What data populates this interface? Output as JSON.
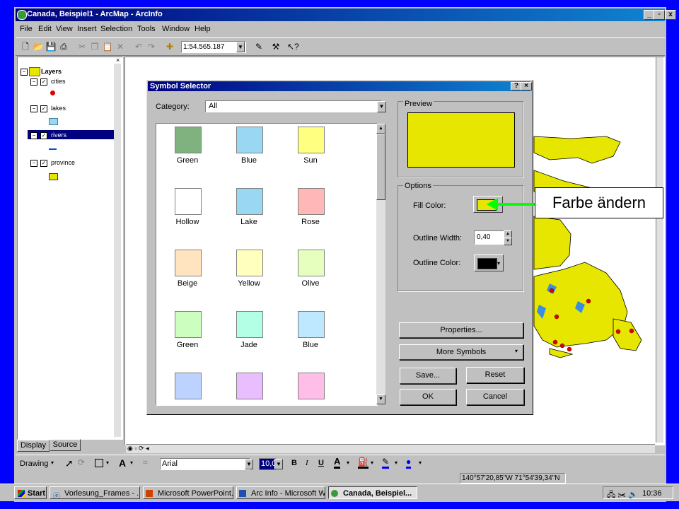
{
  "window": {
    "title": "Canada, Beispiel1 - ArcMap - ArcInfo",
    "controls": [
      "_",
      "▫",
      "x"
    ]
  },
  "menu": [
    "File",
    "Edit",
    "View",
    "Insert",
    "Selection",
    "Tools",
    "Window",
    "Help"
  ],
  "toolbar": {
    "scale": "1:54.565.187"
  },
  "toc": {
    "root": "Layers",
    "layers": [
      {
        "name": "cities",
        "symbol": "red-dot"
      },
      {
        "name": "lakes",
        "symbol": "light-blue-rect"
      },
      {
        "name": "rivers",
        "symbol": "blue-line",
        "selected": true
      },
      {
        "name": "province",
        "symbol": "yellow-rect"
      }
    ],
    "tabs": [
      "Display",
      "Source"
    ]
  },
  "dialog": {
    "title": "Symbol Selector",
    "category_label": "Category:",
    "category_value": "All",
    "symbols": [
      {
        "label": "Green",
        "color": "#7fb27f"
      },
      {
        "label": "Blue",
        "color": "#9ad7f3"
      },
      {
        "label": "Sun",
        "color": "#ffff80"
      },
      {
        "label": "Hollow",
        "color": "#ffffff"
      },
      {
        "label": "Lake",
        "color": "#9ad7f3"
      },
      {
        "label": "Rose",
        "color": "#ffb7b7"
      },
      {
        "label": "Beige",
        "color": "#ffe4bf"
      },
      {
        "label": "Yellow",
        "color": "#ffffbe"
      },
      {
        "label": "Olive",
        "color": "#e6ffbf"
      },
      {
        "label": "Green",
        "color": "#ccffbf"
      },
      {
        "label": "Jade",
        "color": "#b3ffe6"
      },
      {
        "label": "Blue",
        "color": "#bee8ff"
      },
      {
        "label": "",
        "color": "#bed2ff"
      },
      {
        "label": "",
        "color": "#e8beff"
      },
      {
        "label": "",
        "color": "#ffbee8"
      }
    ],
    "preview_label": "Preview",
    "preview_color": "#e6e600",
    "options_label": "Options",
    "fill_color_label": "Fill Color:",
    "outline_width_label": "Outline Width:",
    "outline_width_value": "0,40",
    "outline_color_label": "Outline Color:",
    "buttons": {
      "properties": "Properties...",
      "more_symbols": "More Symbols",
      "save": "Save...",
      "reset": "Reset",
      "ok": "OK",
      "cancel": "Cancel"
    }
  },
  "drawing_toolbar": {
    "drawing": "Drawing",
    "font": "Arial",
    "size": "10,0",
    "bold": "B",
    "italic": "I",
    "underline": "U",
    "font_color_letter": "A",
    "text_tool_letter": "A"
  },
  "status": {
    "coords": "140°57'20,85\"W  71°54'39,34\"N"
  },
  "taskbar": {
    "start": "Start",
    "tasks": [
      "Vorlesung_Frames - ...",
      "Microsoft PowerPoint...",
      "Arc Info - Microsoft W...",
      "Canada, Beispiel..."
    ],
    "clock": "10:36"
  },
  "callout": {
    "text": "Farbe ändern",
    "arrow_color": "#00ff00"
  }
}
